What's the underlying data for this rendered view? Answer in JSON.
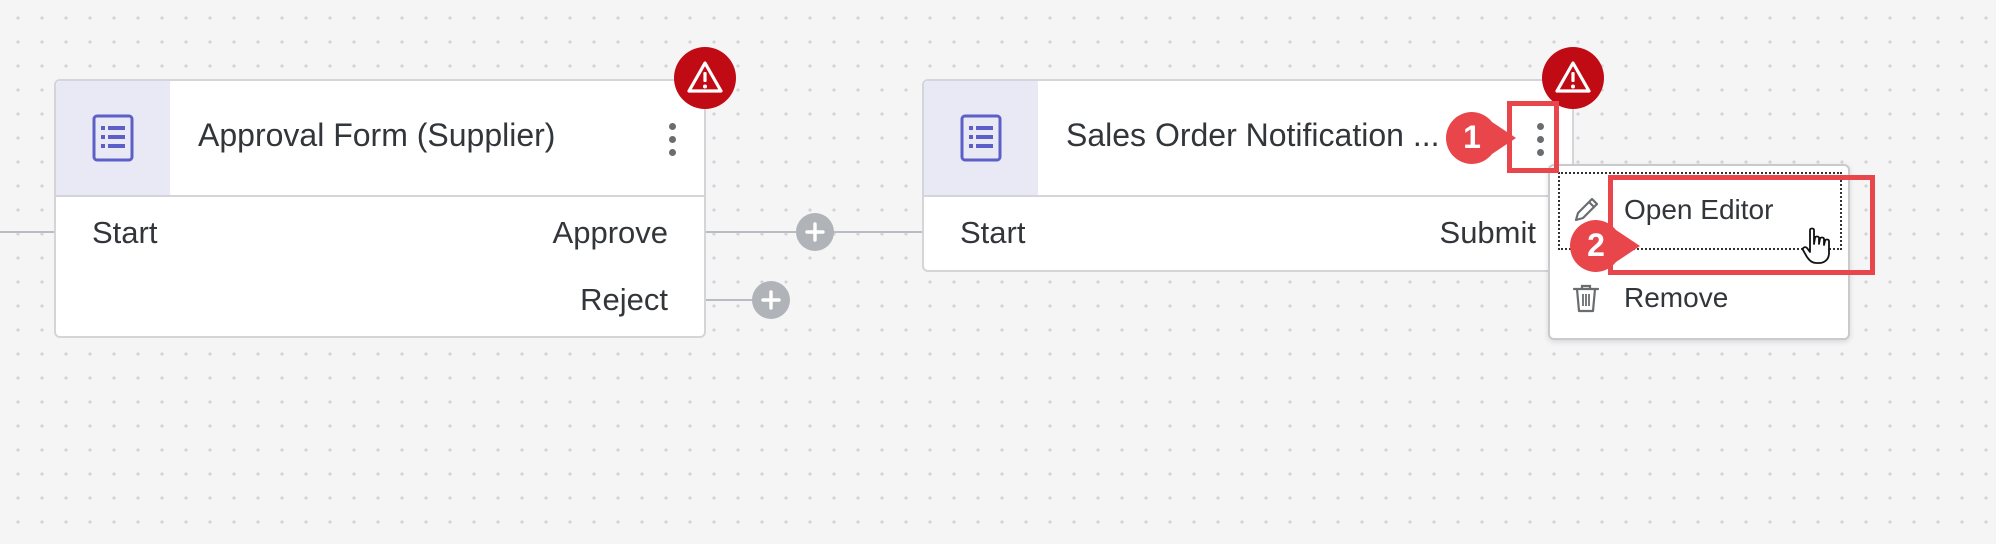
{
  "nodes": [
    {
      "title": "Approval Form (Supplier)",
      "ports_left": [
        "Start"
      ],
      "ports_right": [
        "Approve",
        "Reject"
      ],
      "icon": "form-icon",
      "warning_icon": "warning-icon"
    },
    {
      "title": "Sales Order Notification ...",
      "ports_left": [
        "Start"
      ],
      "ports_right": [
        "Submit"
      ],
      "icon": "form-icon",
      "warning_icon": "warning-icon"
    }
  ],
  "context_menu": {
    "items": [
      {
        "label": "Open Editor",
        "icon": "pencil-icon"
      },
      {
        "label": "Remove",
        "icon": "trash-icon"
      }
    ]
  },
  "annotations": {
    "steps": [
      "1",
      "2"
    ],
    "color": "#e8464b"
  },
  "colors": {
    "warning": "#c00a14",
    "icon_accent": "#5b5fc7",
    "icon_bg": "#e9e9f5"
  }
}
